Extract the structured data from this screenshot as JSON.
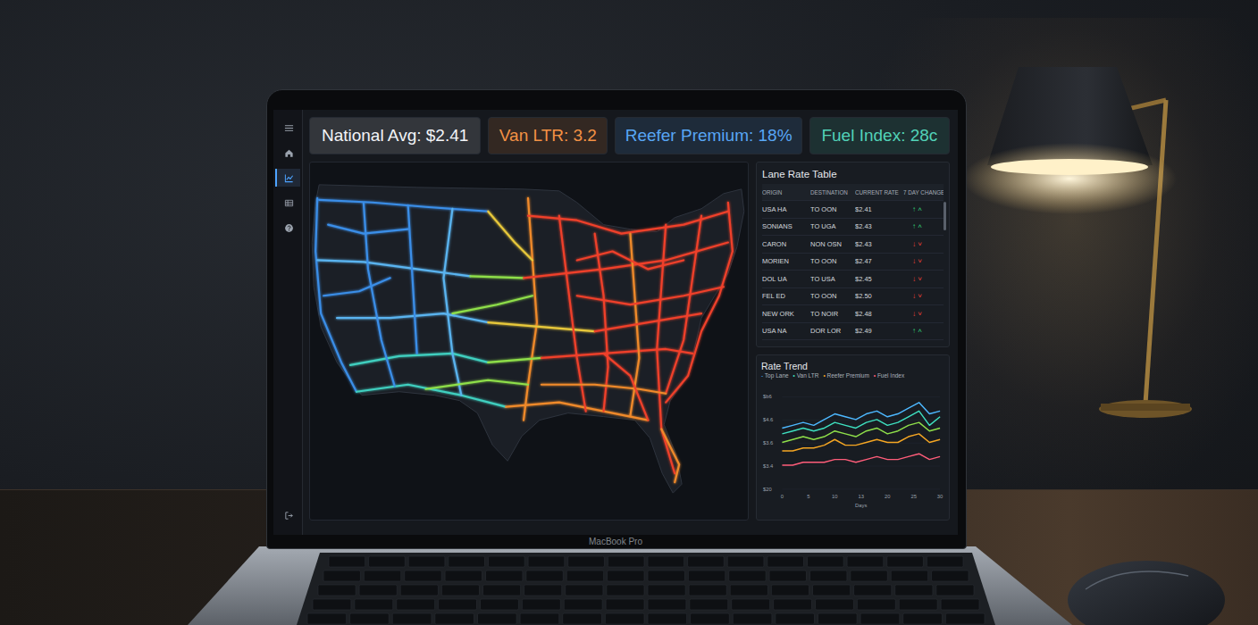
{
  "device_label": "MacBook Pro",
  "sidebar": {
    "items": [
      {
        "kind": "menu",
        "selected": false
      },
      {
        "kind": "home",
        "selected": false
      },
      {
        "kind": "chart",
        "selected": true
      },
      {
        "kind": "table",
        "selected": false
      },
      {
        "kind": "help",
        "selected": false
      },
      {
        "kind": "logout",
        "selected": false
      }
    ]
  },
  "kpis": [
    {
      "label": "National Avg: $2.41",
      "color": "#f2f4f7"
    },
    {
      "label": "Van LTR: 3.2",
      "color": "#f39245"
    },
    {
      "label": "Reefer Premium: 18%",
      "color": "#58a6f5"
    },
    {
      "label": "Fuel Index: 28c",
      "color": "#52d3b8"
    }
  ],
  "lane_table": {
    "title": "Lane Rate Table",
    "columns": [
      "ORIGIN",
      "DESTINATION",
      "CURRENT RATE",
      "7 DAY CHANGE"
    ],
    "rows": [
      {
        "origin": "USA HA",
        "destination": "TO OON",
        "rate": "$2.41",
        "change": "↑ ˄",
        "color": "#34d07a"
      },
      {
        "origin": "SONIANS",
        "destination": "TO UGA",
        "rate": "$2.43",
        "change": "↑ ˄",
        "color": "#34d07a"
      },
      {
        "origin": "CARON",
        "destination": "NON OSN",
        "rate": "$2.43",
        "change": "↓ ˅",
        "color": "#f0453a"
      },
      {
        "origin": "MORIEN",
        "destination": "TO OON",
        "rate": "$2.47",
        "change": "↓ ˅",
        "color": "#f0453a"
      },
      {
        "origin": "DOL UA",
        "destination": "TO USA",
        "rate": "$2.45",
        "change": "↓ ˅",
        "color": "#f0453a"
      },
      {
        "origin": "FEL ED",
        "destination": "TO OON",
        "rate": "$2.50",
        "change": "↓ ˅",
        "color": "#f0453a"
      },
      {
        "origin": "NEW ORK",
        "destination": "TO NOIR",
        "rate": "$2.48",
        "change": "↓ ˅",
        "color": "#f0453a"
      },
      {
        "origin": "USA NA",
        "destination": "DOR LOR",
        "rate": "$2.49",
        "change": "↑ ˄",
        "color": "#34d07a"
      }
    ]
  },
  "rate_trend": {
    "title": "Rate Trend",
    "legend": [
      {
        "marker": "-",
        "label": "Top Lane",
        "color": "#4db8ff"
      },
      {
        "marker": "•",
        "label": "Van LTR",
        "color": "#3ee0c0"
      },
      {
        "marker": "•",
        "label": "Reefer Premium",
        "color": "#f5a623"
      },
      {
        "marker": "•",
        "label": "Fuel Index",
        "color": "#ff5d7a"
      }
    ],
    "y_ticks": [
      "$b6",
      "$4.6",
      "$3.6",
      "$3.4",
      "$20"
    ],
    "x_ticks": [
      "0",
      "5",
      "10",
      "13",
      "20",
      "25",
      "30"
    ],
    "x_label": "Days",
    "days": [
      0,
      2,
      4,
      6,
      8,
      10,
      12,
      14,
      16,
      18,
      20,
      22,
      24,
      26,
      28,
      30
    ],
    "series": [
      {
        "color": "#4db8ff",
        "values": [
          3.9,
          4.0,
          4.1,
          4.0,
          4.2,
          4.4,
          4.3,
          4.2,
          4.4,
          4.5,
          4.3,
          4.4,
          4.6,
          4.8,
          4.4,
          4.5
        ]
      },
      {
        "color": "#3ee0c0",
        "values": [
          3.7,
          3.8,
          3.9,
          3.8,
          3.9,
          4.1,
          4.0,
          3.9,
          4.1,
          4.2,
          4.0,
          4.1,
          4.3,
          4.5,
          4.0,
          4.3
        ]
      },
      {
        "color": "#8fe04a",
        "values": [
          3.4,
          3.5,
          3.6,
          3.5,
          3.6,
          3.8,
          3.7,
          3.6,
          3.8,
          3.9,
          3.7,
          3.8,
          4.0,
          4.1,
          3.8,
          3.9
        ]
      },
      {
        "color": "#f5a623",
        "values": [
          3.1,
          3.1,
          3.2,
          3.2,
          3.3,
          3.5,
          3.3,
          3.3,
          3.4,
          3.5,
          3.4,
          3.4,
          3.6,
          3.7,
          3.4,
          3.5
        ]
      },
      {
        "color": "#ff5d7a",
        "values": [
          2.6,
          2.6,
          2.7,
          2.7,
          2.7,
          2.8,
          2.8,
          2.7,
          2.8,
          2.9,
          2.8,
          2.8,
          2.9,
          3.0,
          2.8,
          2.9
        ]
      }
    ]
  }
}
